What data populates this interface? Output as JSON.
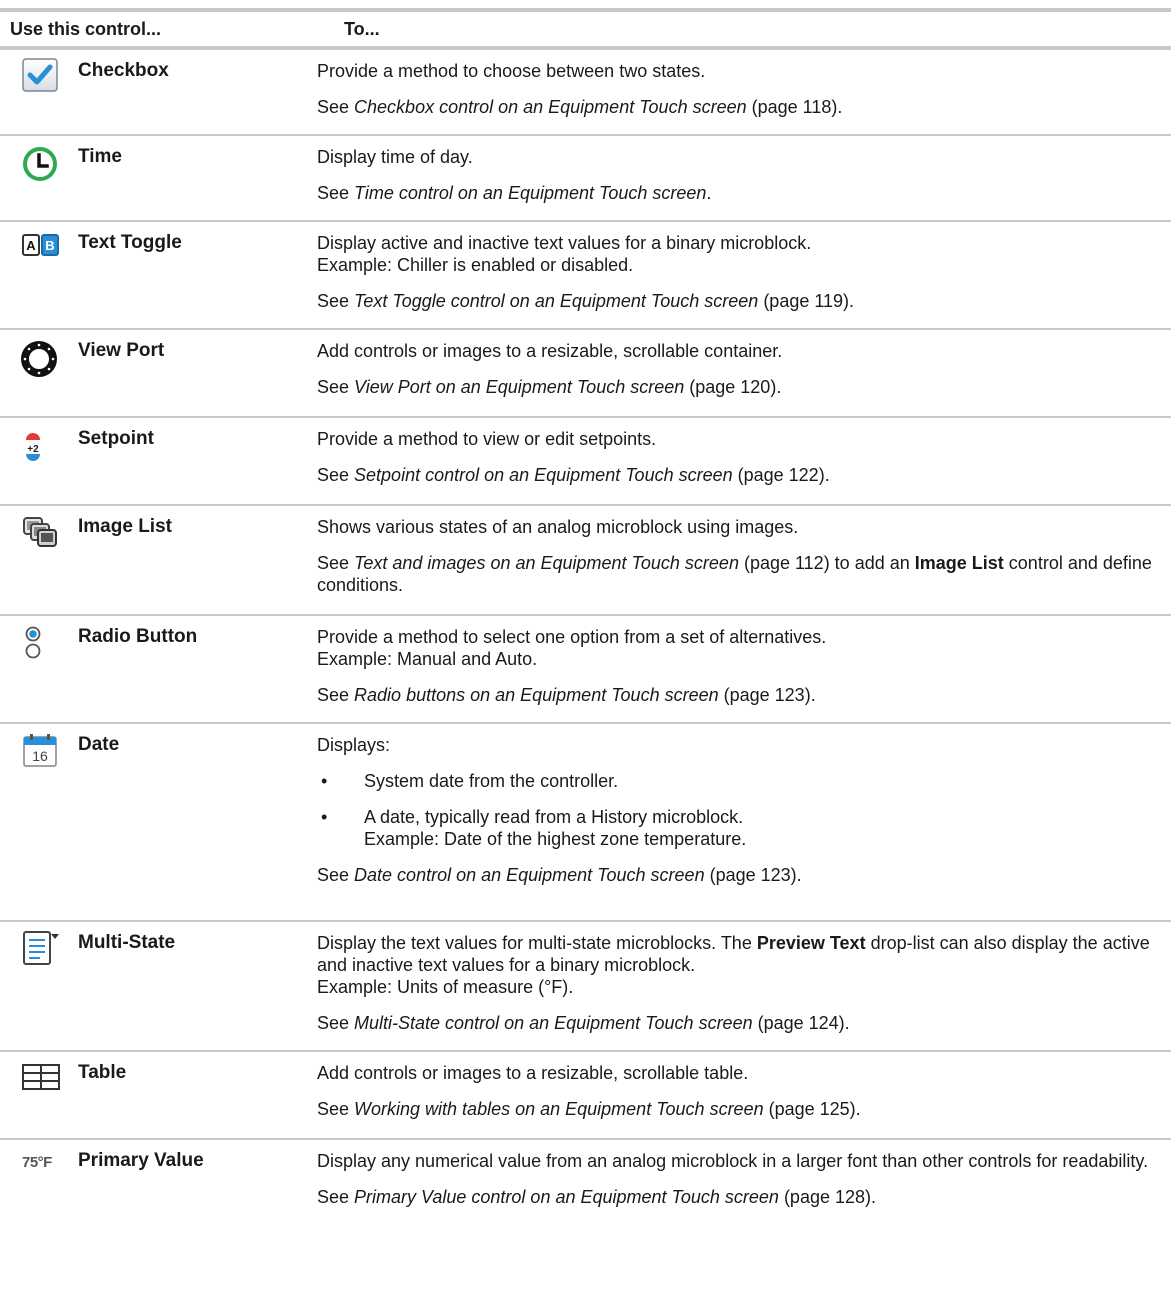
{
  "header": {
    "col1": "Use this control...",
    "col2": "To..."
  },
  "rows": [
    {
      "name": "Checkbox",
      "icon": "checkbox-icon",
      "desc1": "Provide a method to choose between two states.",
      "see_prefix": "See ",
      "see_ref": "Checkbox control on an Equipment Touch screen",
      "see_suffix": " (page 118)."
    },
    {
      "name": "Time",
      "icon": "clock-icon",
      "desc1": "Display time of day.",
      "see_prefix": "See ",
      "see_ref": "Time control on an Equipment Touch screen",
      "see_suffix": "."
    },
    {
      "name": "Text Toggle",
      "icon": "text-toggle-icon",
      "desc1": "Display active and inactive text values for a binary microblock.",
      "desc2": "Example: Chiller is enabled or disabled.",
      "see_prefix": "See ",
      "see_ref": "Text Toggle control on an Equipment Touch screen",
      "see_suffix": " (page 119)."
    },
    {
      "name": "View Port",
      "icon": "view-port-icon",
      "desc1": "Add controls or images to a resizable, scrollable container.",
      "see_prefix": "See ",
      "see_ref": "View Port on an Equipment Touch screen",
      "see_suffix": " (page 120)."
    },
    {
      "name": "Setpoint",
      "icon": "setpoint-icon",
      "desc1": "Provide a method to view or edit setpoints.",
      "see_prefix": "See ",
      "see_ref": "Setpoint control on an Equipment Touch screen",
      "see_suffix": " (page 122)."
    },
    {
      "name": "Image List",
      "icon": "image-list-icon",
      "desc1": "Shows various states of an analog microblock using images.",
      "see_prefix": "See ",
      "see_ref": "Text and images on an Equipment Touch screen",
      "see_suffix": " (page 112) to add an ",
      "see_bold": "Image List",
      "see_tail": " control and define conditions."
    },
    {
      "name": "Radio Button",
      "icon": "radio-button-icon",
      "desc1": "Provide a method to select one option from a set of alternatives.",
      "desc2": "Example: Manual and Auto.",
      "see_prefix": "See ",
      "see_ref": "Radio buttons on an Equipment Touch screen",
      "see_suffix": " (page 123)."
    },
    {
      "name": "Date",
      "icon": "calendar-icon",
      "icon_text": "16",
      "desc1": "Displays:",
      "bullet1": "System date from the controller.",
      "bullet2a": "A date, typically read from a History microblock.",
      "bullet2b": "Example: Date of the highest zone temperature.",
      "see_prefix": "See ",
      "see_ref": "Date control on an Equipment Touch screen",
      "see_suffix": " (page 123)."
    },
    {
      "name": "Multi-State",
      "icon": "multi-state-icon",
      "desc1a": "Display the text values for multi-state microblocks. The ",
      "desc1b": "Preview Text",
      "desc1c": " drop-list can also display the active and inactive text values for a binary microblock.",
      "desc2": "Example: Units of measure (°F).",
      "see_prefix": "See ",
      "see_ref": "Multi-State control on an Equipment Touch screen",
      "see_suffix": " (page 124)."
    },
    {
      "name": "Table",
      "icon": "table-icon",
      "desc1": "Add controls or images to a resizable, scrollable table.",
      "see_prefix": "See ",
      "see_ref": "Working with tables on an Equipment Touch screen",
      "see_suffix": " (page 125)."
    },
    {
      "name": "Primary Value",
      "icon": "primary-value-icon",
      "icon_text": "75°F",
      "desc1": "Display any numerical value from an analog microblock in a larger font than other controls for readability.",
      "see_prefix": "See ",
      "see_ref": "Primary Value control on an Equipment Touch screen",
      "see_suffix": " (page 128)."
    }
  ]
}
